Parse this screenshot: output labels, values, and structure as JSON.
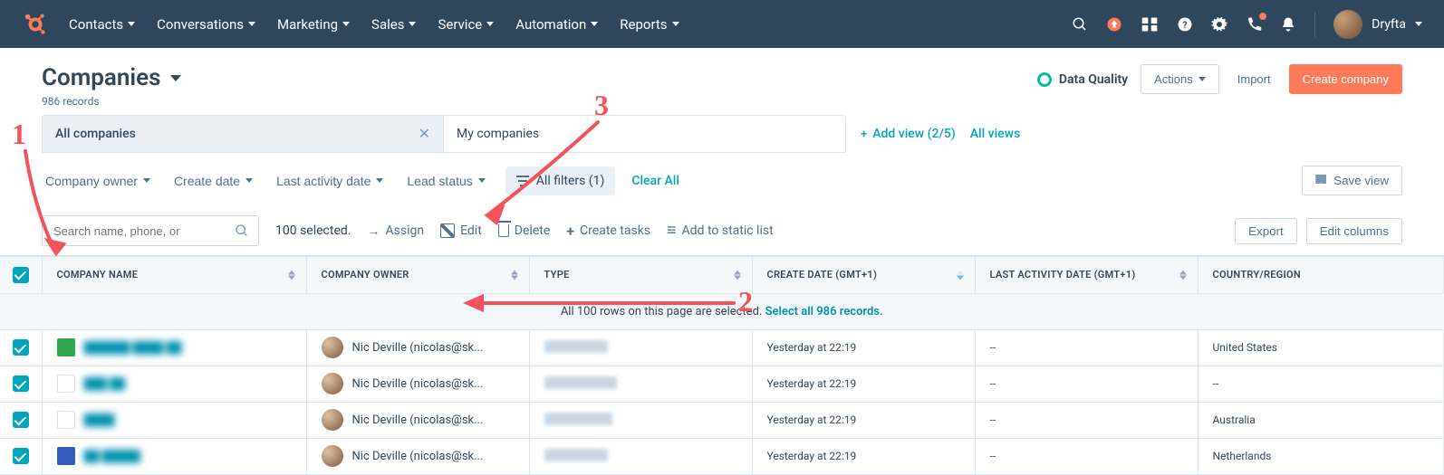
{
  "nav": {
    "items": [
      "Contacts",
      "Conversations",
      "Marketing",
      "Sales",
      "Service",
      "Automation",
      "Reports"
    ],
    "account_name": "Dryfta"
  },
  "header": {
    "title": "Companies",
    "records_count": "986 records",
    "data_quality": "Data Quality",
    "actions_label": "Actions",
    "import_label": "Import",
    "create_label": "Create company"
  },
  "view_tabs": {
    "tabs": [
      "All companies",
      "My companies"
    ],
    "add_view": "Add view (2/5)",
    "all_views": "All views"
  },
  "filters": {
    "company_owner": "Company owner",
    "create_date": "Create date",
    "last_activity_date": "Last activity date",
    "lead_status": "Lead status",
    "all_filters": "All filters (1)",
    "clear_all": "Clear All",
    "save_view": "Save view"
  },
  "bulk": {
    "search_placeholder": "Search name, phone, or",
    "selected_text": "100 selected.",
    "assign": "Assign",
    "edit": "Edit",
    "delete": "Delete",
    "create_tasks": "Create tasks",
    "add_static": "Add to static list",
    "export": "Export",
    "edit_columns": "Edit columns"
  },
  "table": {
    "headers": {
      "name": "Company name",
      "owner": "Company owner",
      "type": "Type",
      "created": "Create Date (GMT+1)",
      "activity": "Last Activity Date (GMT+1)",
      "country": "Country/Region"
    },
    "select_banner_prefix": "All 100 rows on this page are selected.",
    "select_banner_link": "Select all 986 records.",
    "rows": [
      {
        "logo_color": "#2fa84f",
        "owner": "Nic Deville (nicolas@sk...",
        "created": "Yesterday at 22:19",
        "activity": "--",
        "country": "United States"
      },
      {
        "logo_color": "#ffffff",
        "owner": "Nic Deville (nicolas@sk...",
        "created": "Yesterday at 22:19",
        "activity": "--",
        "country": "--"
      },
      {
        "logo_color": "#ffffff",
        "owner": "Nic Deville (nicolas@sk...",
        "created": "Yesterday at 22:19",
        "activity": "--",
        "country": "Australia"
      },
      {
        "logo_color": "#2f5db8",
        "owner": "Nic Deville (nicolas@sk...",
        "created": "Yesterday at 22:19",
        "activity": "--",
        "country": "Netherlands"
      }
    ]
  },
  "annotations": {
    "n1": "1",
    "n2": "2",
    "n3": "3"
  }
}
